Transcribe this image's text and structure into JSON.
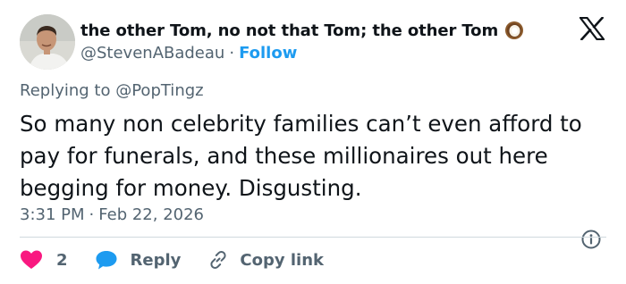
{
  "author": {
    "display_name": "the other Tom, no not that Tom; the other Tom",
    "handle": "@StevenABadeau",
    "separator": "·",
    "follow_label": "Follow"
  },
  "reply_context": {
    "prefix": "Replying to",
    "handle": "@PopTingz"
  },
  "tweet": {
    "text": "So many non celebrity families can’t even afford to pay for funerals, and these millionaires out here begging for money. Disgusting.",
    "time": "3:31 PM",
    "separator": "·",
    "date": "Feb 22, 2026"
  },
  "actions": {
    "like_count": "2",
    "reply_label": "Reply",
    "copy_link_label": "Copy link"
  },
  "icons": {
    "brand": "x-logo-icon",
    "emoji": "coconut-icon",
    "like": "heart-icon",
    "reply": "speech-bubble-icon",
    "copy": "link-icon",
    "info": "info-icon"
  },
  "colors": {
    "text": "#0f1419",
    "secondary": "#536471",
    "link": "#1d9bf0",
    "like": "#f91880",
    "reply": "#1d9bf0",
    "divider": "#cfd9de"
  }
}
